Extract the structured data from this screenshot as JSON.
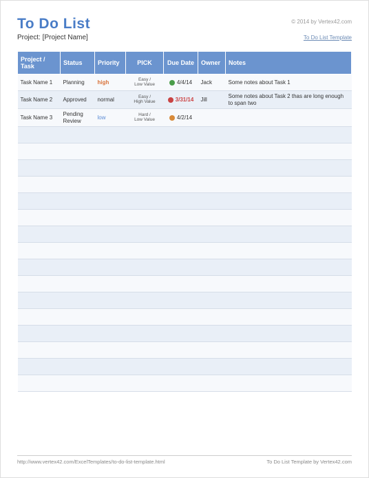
{
  "header": {
    "title": "To Do List",
    "copyright": "© 2014 by Vertex42.com",
    "project_label": "Project: [Project Name]",
    "template_link": "To Do List Template"
  },
  "columns": {
    "task": "Project / Task",
    "status": "Status",
    "priority": "Priority",
    "pick": "PICK",
    "due": "Due Date",
    "owner": "Owner",
    "notes": "Notes"
  },
  "rows": [
    {
      "task": "Task Name 1",
      "status": "Planning",
      "priority": "high",
      "priority_class": "priority-high",
      "pick": "Easy / Low Value",
      "dot": "dot-green",
      "due": "4/4/14",
      "due_class": "",
      "owner": "Jack",
      "notes": "Some notes about Task 1"
    },
    {
      "task": "Task Name 2",
      "status": "Approved",
      "priority": "normal",
      "priority_class": "",
      "pick": "Easy / High Value",
      "dot": "dot-red",
      "due": "3/31/14",
      "due_class": "due-overdue",
      "owner": "Jill",
      "notes": "Some notes about Task 2 thas are long enough to span two"
    },
    {
      "task": "Task Name 3",
      "status": "Pending Review",
      "priority": "low",
      "priority_class": "priority-low",
      "pick": "Hard / Low Value",
      "dot": "dot-orange",
      "due": "4/2/14",
      "due_class": "",
      "owner": "",
      "notes": ""
    }
  ],
  "empty_rows": 16,
  "footer": {
    "url": "http://www.vertex42.com/ExcelTemplates/to-do-list-template.html",
    "credit": "To Do List Template by Vertex42.com"
  }
}
